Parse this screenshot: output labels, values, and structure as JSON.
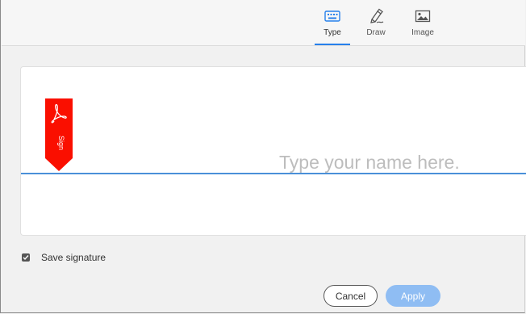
{
  "tabs": [
    {
      "label": "Type",
      "icon": "keyboard-icon",
      "active": true
    },
    {
      "label": "Draw",
      "icon": "pen-icon",
      "active": false
    },
    {
      "label": "Image",
      "icon": "image-icon",
      "active": false
    }
  ],
  "signature": {
    "badge_text": "Sign",
    "badge_icon": "acrobat-icon",
    "placeholder": "Type your name here."
  },
  "save_signature": {
    "label": "Save signature",
    "checked": true
  },
  "buttons": {
    "cancel": "Cancel",
    "apply": "Apply"
  },
  "colors": {
    "accent": "#2680eb",
    "signature_line": "#4a90d9",
    "badge_red": "#fa0f00",
    "apply_disabled": "#8fbdf3"
  }
}
